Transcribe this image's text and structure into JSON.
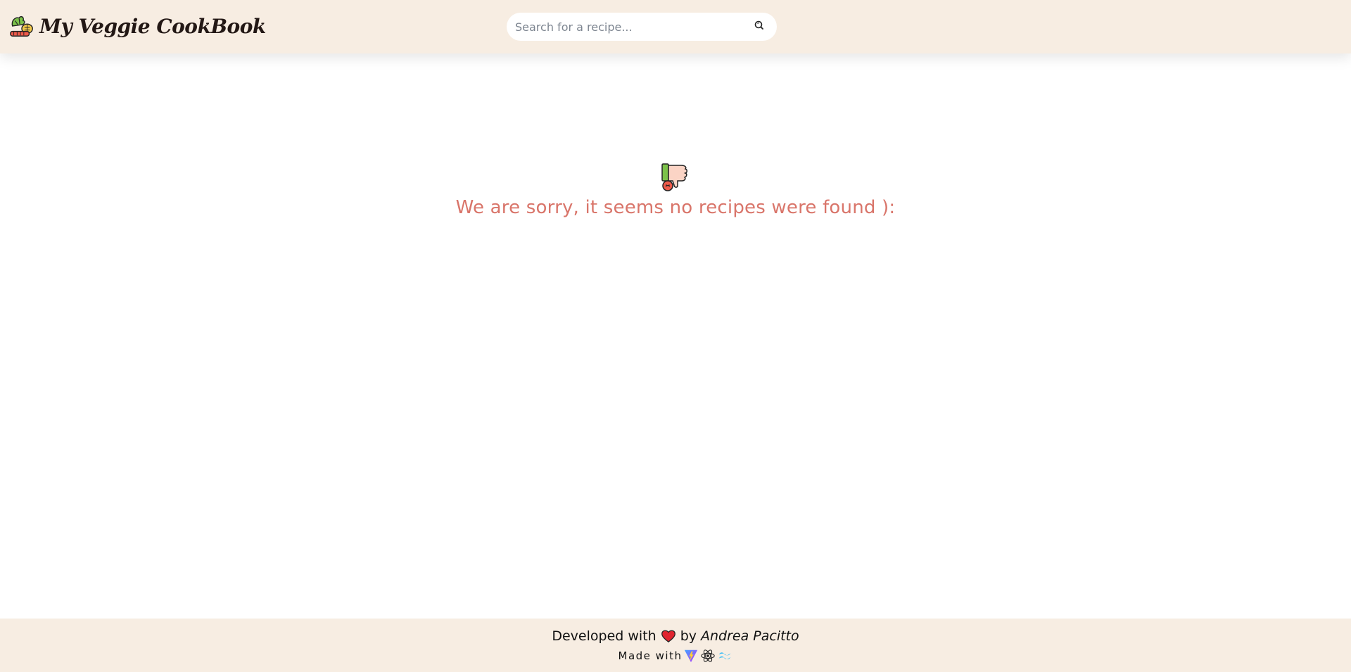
{
  "header": {
    "title": "My Veggie CookBook",
    "logo_icon": "veggie-basket-icon"
  },
  "search": {
    "placeholder": "Search for a recipe...",
    "value": "",
    "icon": "search-icon"
  },
  "empty_state": {
    "icon": "thumbs-down-veggie-icon",
    "message": "We are sorry, it seems no recipes were found ):"
  },
  "footer": {
    "developed_prefix": "Developed with",
    "heart_icon": "heart-icon",
    "by_text": "by",
    "author": "Andrea Pacitto",
    "made_with": "Made with",
    "tech_icons": [
      "vite-icon",
      "react-icon",
      "tailwind-icon"
    ]
  },
  "colors": {
    "header_bg": "#f7ede2",
    "message": "#d9756a",
    "heart": "#e0242f"
  }
}
